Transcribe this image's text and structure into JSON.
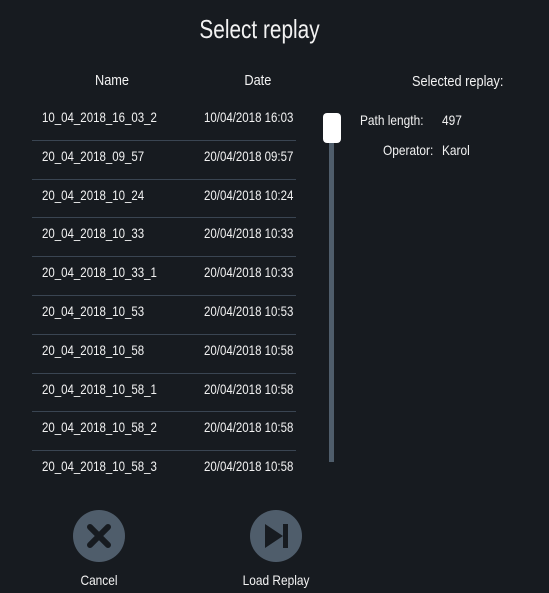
{
  "title": "Select replay",
  "list": {
    "headers": {
      "name": "Name",
      "date": "Date"
    },
    "rows": [
      {
        "name": "10_04_2018_16_03_2",
        "date": "10/04/2018 16:03"
      },
      {
        "name": "20_04_2018_09_57",
        "date": "20/04/2018 09:57"
      },
      {
        "name": "20_04_2018_10_24",
        "date": "20/04/2018 10:24"
      },
      {
        "name": "20_04_2018_10_33",
        "date": "20/04/2018 10:33"
      },
      {
        "name": "20_04_2018_10_33_1",
        "date": "20/04/2018 10:33"
      },
      {
        "name": "20_04_2018_10_53",
        "date": "20/04/2018 10:53"
      },
      {
        "name": "20_04_2018_10_58",
        "date": "20/04/2018 10:58"
      },
      {
        "name": "20_04_2018_10_58_1",
        "date": "20/04/2018 10:58"
      },
      {
        "name": "20_04_2018_10_58_2",
        "date": "20/04/2018 10:58"
      },
      {
        "name": "20_04_2018_10_58_3",
        "date": "20/04/2018 10:58"
      }
    ]
  },
  "scrollbar": {
    "position": 0
  },
  "selected": {
    "heading": "Selected replay:",
    "path_label": "Path length:",
    "path_value": "497",
    "operator_label": "Operator:",
    "operator_value": "Karol"
  },
  "buttons": {
    "cancel": "Cancel",
    "load": "Load Replay"
  },
  "colors": {
    "background": "#171b20",
    "button": "#4f5d6b",
    "separator": "#3a4552"
  }
}
